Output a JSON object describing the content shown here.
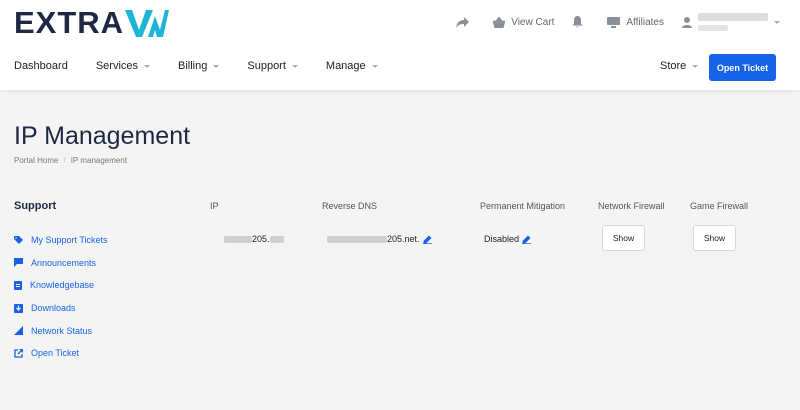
{
  "brand": {
    "logo_text": "EXTRA",
    "logo_mark": "VM",
    "accent": "#1cb5d8",
    "navy": "#1e2843",
    "primary": "#1663e8"
  },
  "toplinks": {
    "cart_label": "View Cart",
    "affiliates_label": "Affiliates"
  },
  "nav": {
    "items": [
      {
        "label": "Dashboard",
        "dropdown": false
      },
      {
        "label": "Services",
        "dropdown": true
      },
      {
        "label": "Billing",
        "dropdown": true
      },
      {
        "label": "Support",
        "dropdown": true
      },
      {
        "label": "Manage",
        "dropdown": true
      }
    ],
    "store_label": "Store",
    "open_ticket_label": "Open Ticket"
  },
  "page": {
    "title": "IP Management",
    "breadcrumb": [
      "Portal Home",
      "IP management"
    ]
  },
  "sidebar": {
    "title": "Support",
    "items": [
      {
        "label": "My Support Tickets",
        "icon": "ticket-icon"
      },
      {
        "label": "Announcements",
        "icon": "announcement-icon"
      },
      {
        "label": "Knowledgebase",
        "icon": "book-icon"
      },
      {
        "label": "Downloads",
        "icon": "download-icon"
      },
      {
        "label": "Network Status",
        "icon": "signal-icon"
      },
      {
        "label": "Open Ticket",
        "icon": "external-link-icon"
      }
    ]
  },
  "table": {
    "headers": [
      "IP",
      "Reverse DNS",
      "Permanent Mitigation",
      "Network Firewall",
      "Game Firewall"
    ],
    "rows": [
      {
        "ip": "205.",
        "rdns": "205.net.",
        "mitigation": "Disabled",
        "network_firewall": "Show",
        "game_firewall": "Show"
      }
    ]
  }
}
